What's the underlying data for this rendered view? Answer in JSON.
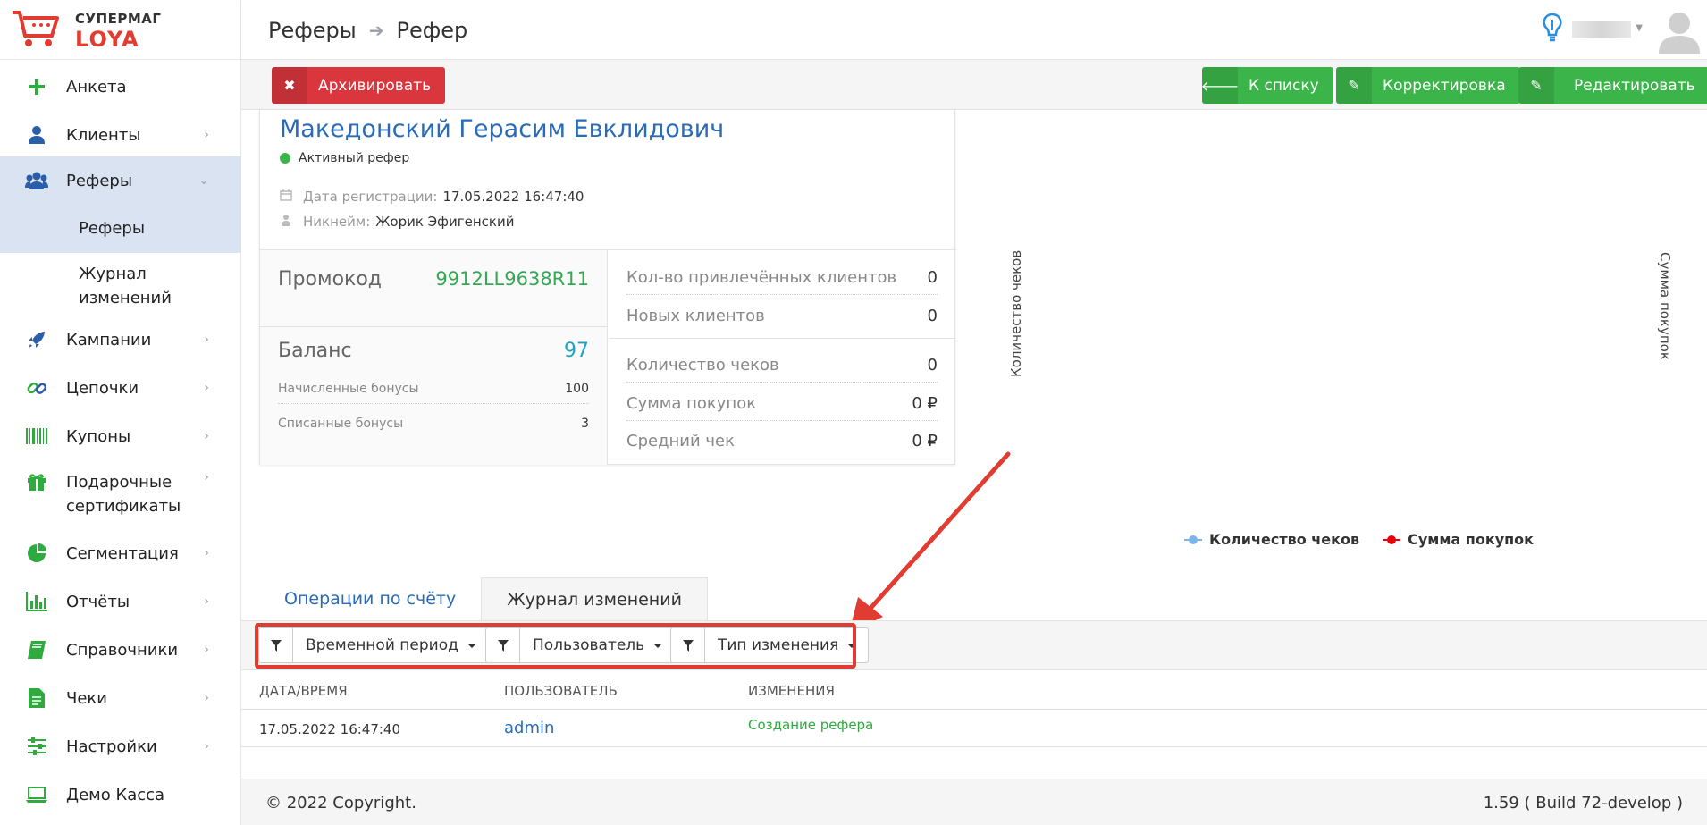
{
  "brand": {
    "top": "СУПЕРМАГ",
    "name": "LOYA"
  },
  "breadcrumb": {
    "parent": "Реферы",
    "current": "Рефер"
  },
  "sidebar": {
    "items": [
      {
        "label": "Анкета",
        "icon": "plus-icon"
      },
      {
        "label": "Клиенты",
        "icon": "user-icon"
      },
      {
        "label": "Реферы",
        "icon": "users-icon"
      },
      {
        "label": "Кампании",
        "icon": "rocket-icon"
      },
      {
        "label": "Цепочки",
        "icon": "link-icon"
      },
      {
        "label": "Купоны",
        "icon": "barcode-icon"
      },
      {
        "label": "Подарочные",
        "label2": "сертификаты",
        "icon": "gift-icon"
      },
      {
        "label": "Сегментация",
        "icon": "pie-chart-icon"
      },
      {
        "label": "Отчёты",
        "icon": "bar-chart-icon"
      },
      {
        "label": "Справочники",
        "icon": "book-icon"
      },
      {
        "label": "Чеки",
        "icon": "document-icon"
      },
      {
        "label": "Настройки",
        "icon": "sliders-icon"
      },
      {
        "label": "Демо Касса",
        "icon": "laptop-icon"
      }
    ],
    "subitems": [
      {
        "label": "Реферы"
      },
      {
        "label": "Журнал",
        "label2": "изменений"
      }
    ]
  },
  "actions": {
    "archive": "Архивировать",
    "to_list": "К списку",
    "correction": "Корректировка",
    "edit": "Редактировать"
  },
  "referrer": {
    "name": "Македонский Герасим Евклидович",
    "status": "Активный рефер",
    "reg_label": "Дата регистрации:",
    "reg_value": "17.05.2022 16:47:40",
    "nick_label": "Никнейм:",
    "nick_value": "Жорик Эфигенский",
    "promo_label": "Промокод",
    "promo_value": "9912LL9638R11",
    "balance_label": "Баланс",
    "balance_value": "97",
    "accrued_label": "Начисленные бонусы",
    "accrued_value": "100",
    "spent_label": "Списанные бонусы",
    "spent_value": "3",
    "stats": [
      {
        "label": "Кол-во привлечённых клиентов",
        "value": "0"
      },
      {
        "label": "Новых клиентов",
        "value": "0"
      },
      {
        "label": "Количество чеков",
        "value": "0"
      },
      {
        "label": "Сумма покупок",
        "value": "0 ₽"
      },
      {
        "label": "Средний чек",
        "value": "0 ₽"
      }
    ]
  },
  "chart": {
    "left_axis": "Количество чеков",
    "right_axis": "Сумма покупок",
    "legend": [
      {
        "name": "Количество чеков",
        "color": "#7cb5ec"
      },
      {
        "name": "Сумма покупок",
        "color": "#e8000b"
      }
    ]
  },
  "tabs": [
    "Операции по счёту",
    "Журнал изменений"
  ],
  "filters": {
    "period": "Временной период",
    "user": "Пользователь",
    "change_type": "Тип изменения"
  },
  "table": {
    "headers": [
      "ДАТА/ВРЕМЯ",
      "ПОЛЬЗОВАТЕЛЬ",
      "ИЗМЕНЕНИЯ"
    ],
    "rows": [
      {
        "datetime": "17.05.2022 16:47:40",
        "user": "admin",
        "change": "Создание рефера"
      }
    ]
  },
  "footer": {
    "copyright": "© 2022 Copyright.",
    "version": "1.59 ( Build 72-develop )"
  },
  "colors": {
    "accent": "#2a6bb8",
    "danger": "#d9363e",
    "success": "#3bb54a",
    "highlight": "#e03c31"
  }
}
